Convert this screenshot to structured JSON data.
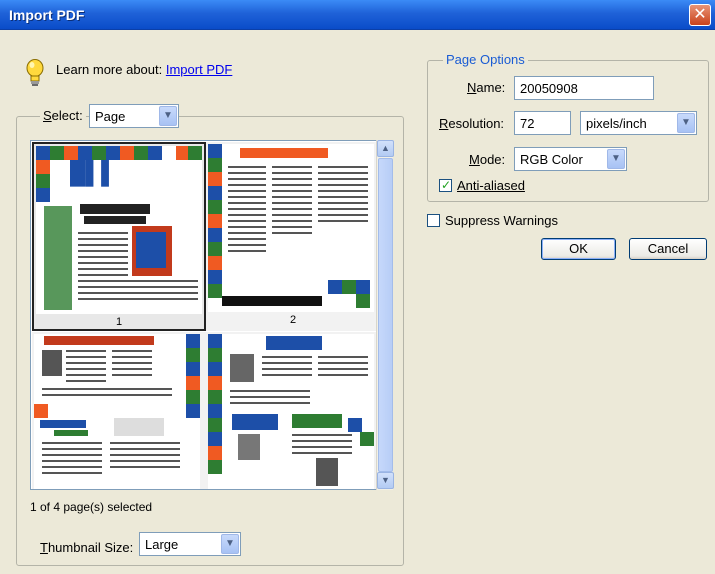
{
  "window": {
    "title": "Import PDF"
  },
  "learn_more": {
    "prefix": "Learn more about: ",
    "link": "Import PDF"
  },
  "select": {
    "label": "Select:",
    "value": "Page"
  },
  "thumbnails": {
    "pages": [
      {
        "number": "1",
        "selected": true
      },
      {
        "number": "2",
        "selected": false
      },
      {
        "number": "",
        "selected": false
      },
      {
        "number": "",
        "selected": false
      }
    ],
    "status": "1 of 4 page(s) selected"
  },
  "thumbnail_size": {
    "label": "Thumbnail Size:",
    "value": "Large"
  },
  "page_options": {
    "title": "Page Options",
    "name_label": "Name:",
    "name_value": "20050908",
    "resolution_label": "Resolution:",
    "resolution_value": "72",
    "resolution_unit": "pixels/inch",
    "mode_label": "Mode:",
    "mode_value": "RGB Color",
    "anti_aliased_label": "Anti-aliased",
    "anti_aliased_checked": true
  },
  "suppress_warnings": {
    "label": "Suppress Warnings",
    "checked": false
  },
  "buttons": {
    "ok": "OK",
    "cancel": "Cancel"
  },
  "colors": {
    "title_bar": "#1f62d8",
    "link": "#0000ee",
    "accent_green": "#2e7d32",
    "accent_orange": "#f05a22",
    "accent_blue": "#1d4fa8"
  }
}
